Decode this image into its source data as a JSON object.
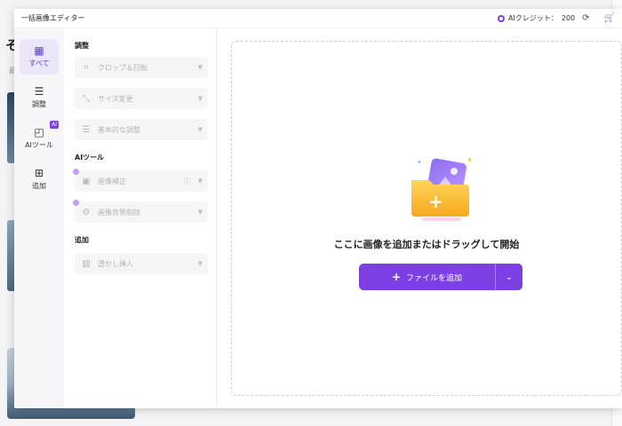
{
  "background": {
    "title": "そ",
    "sub": "最"
  },
  "titlebar": {
    "title": "一括画像エディター",
    "credits_label": "AIクレジット：",
    "credits_value": "200"
  },
  "rail": {
    "items": [
      {
        "label": "すべて",
        "icon": "grid-icon"
      },
      {
        "label": "調整",
        "icon": "sliders-icon"
      },
      {
        "label": "AIツール",
        "icon": "ai-icon",
        "badge": "AI"
      },
      {
        "label": "追加",
        "icon": "plus-square-icon"
      }
    ]
  },
  "panel": {
    "sections": [
      {
        "title": "調整",
        "tools": [
          "クロップ＆回転",
          "サイズ変更",
          "基本的な調整"
        ]
      },
      {
        "title": "AIツール",
        "tools": [
          "画像補正",
          "画像背景削除"
        ]
      },
      {
        "title": "追加",
        "tools": [
          "透かし挿入"
        ]
      }
    ]
  },
  "drop": {
    "text": "ここに画像を追加またはドラッグして開始",
    "button_label": "ファイルを追加"
  },
  "colors": {
    "accent": "#7b3fe4",
    "active_bg": "#ece6fb"
  }
}
